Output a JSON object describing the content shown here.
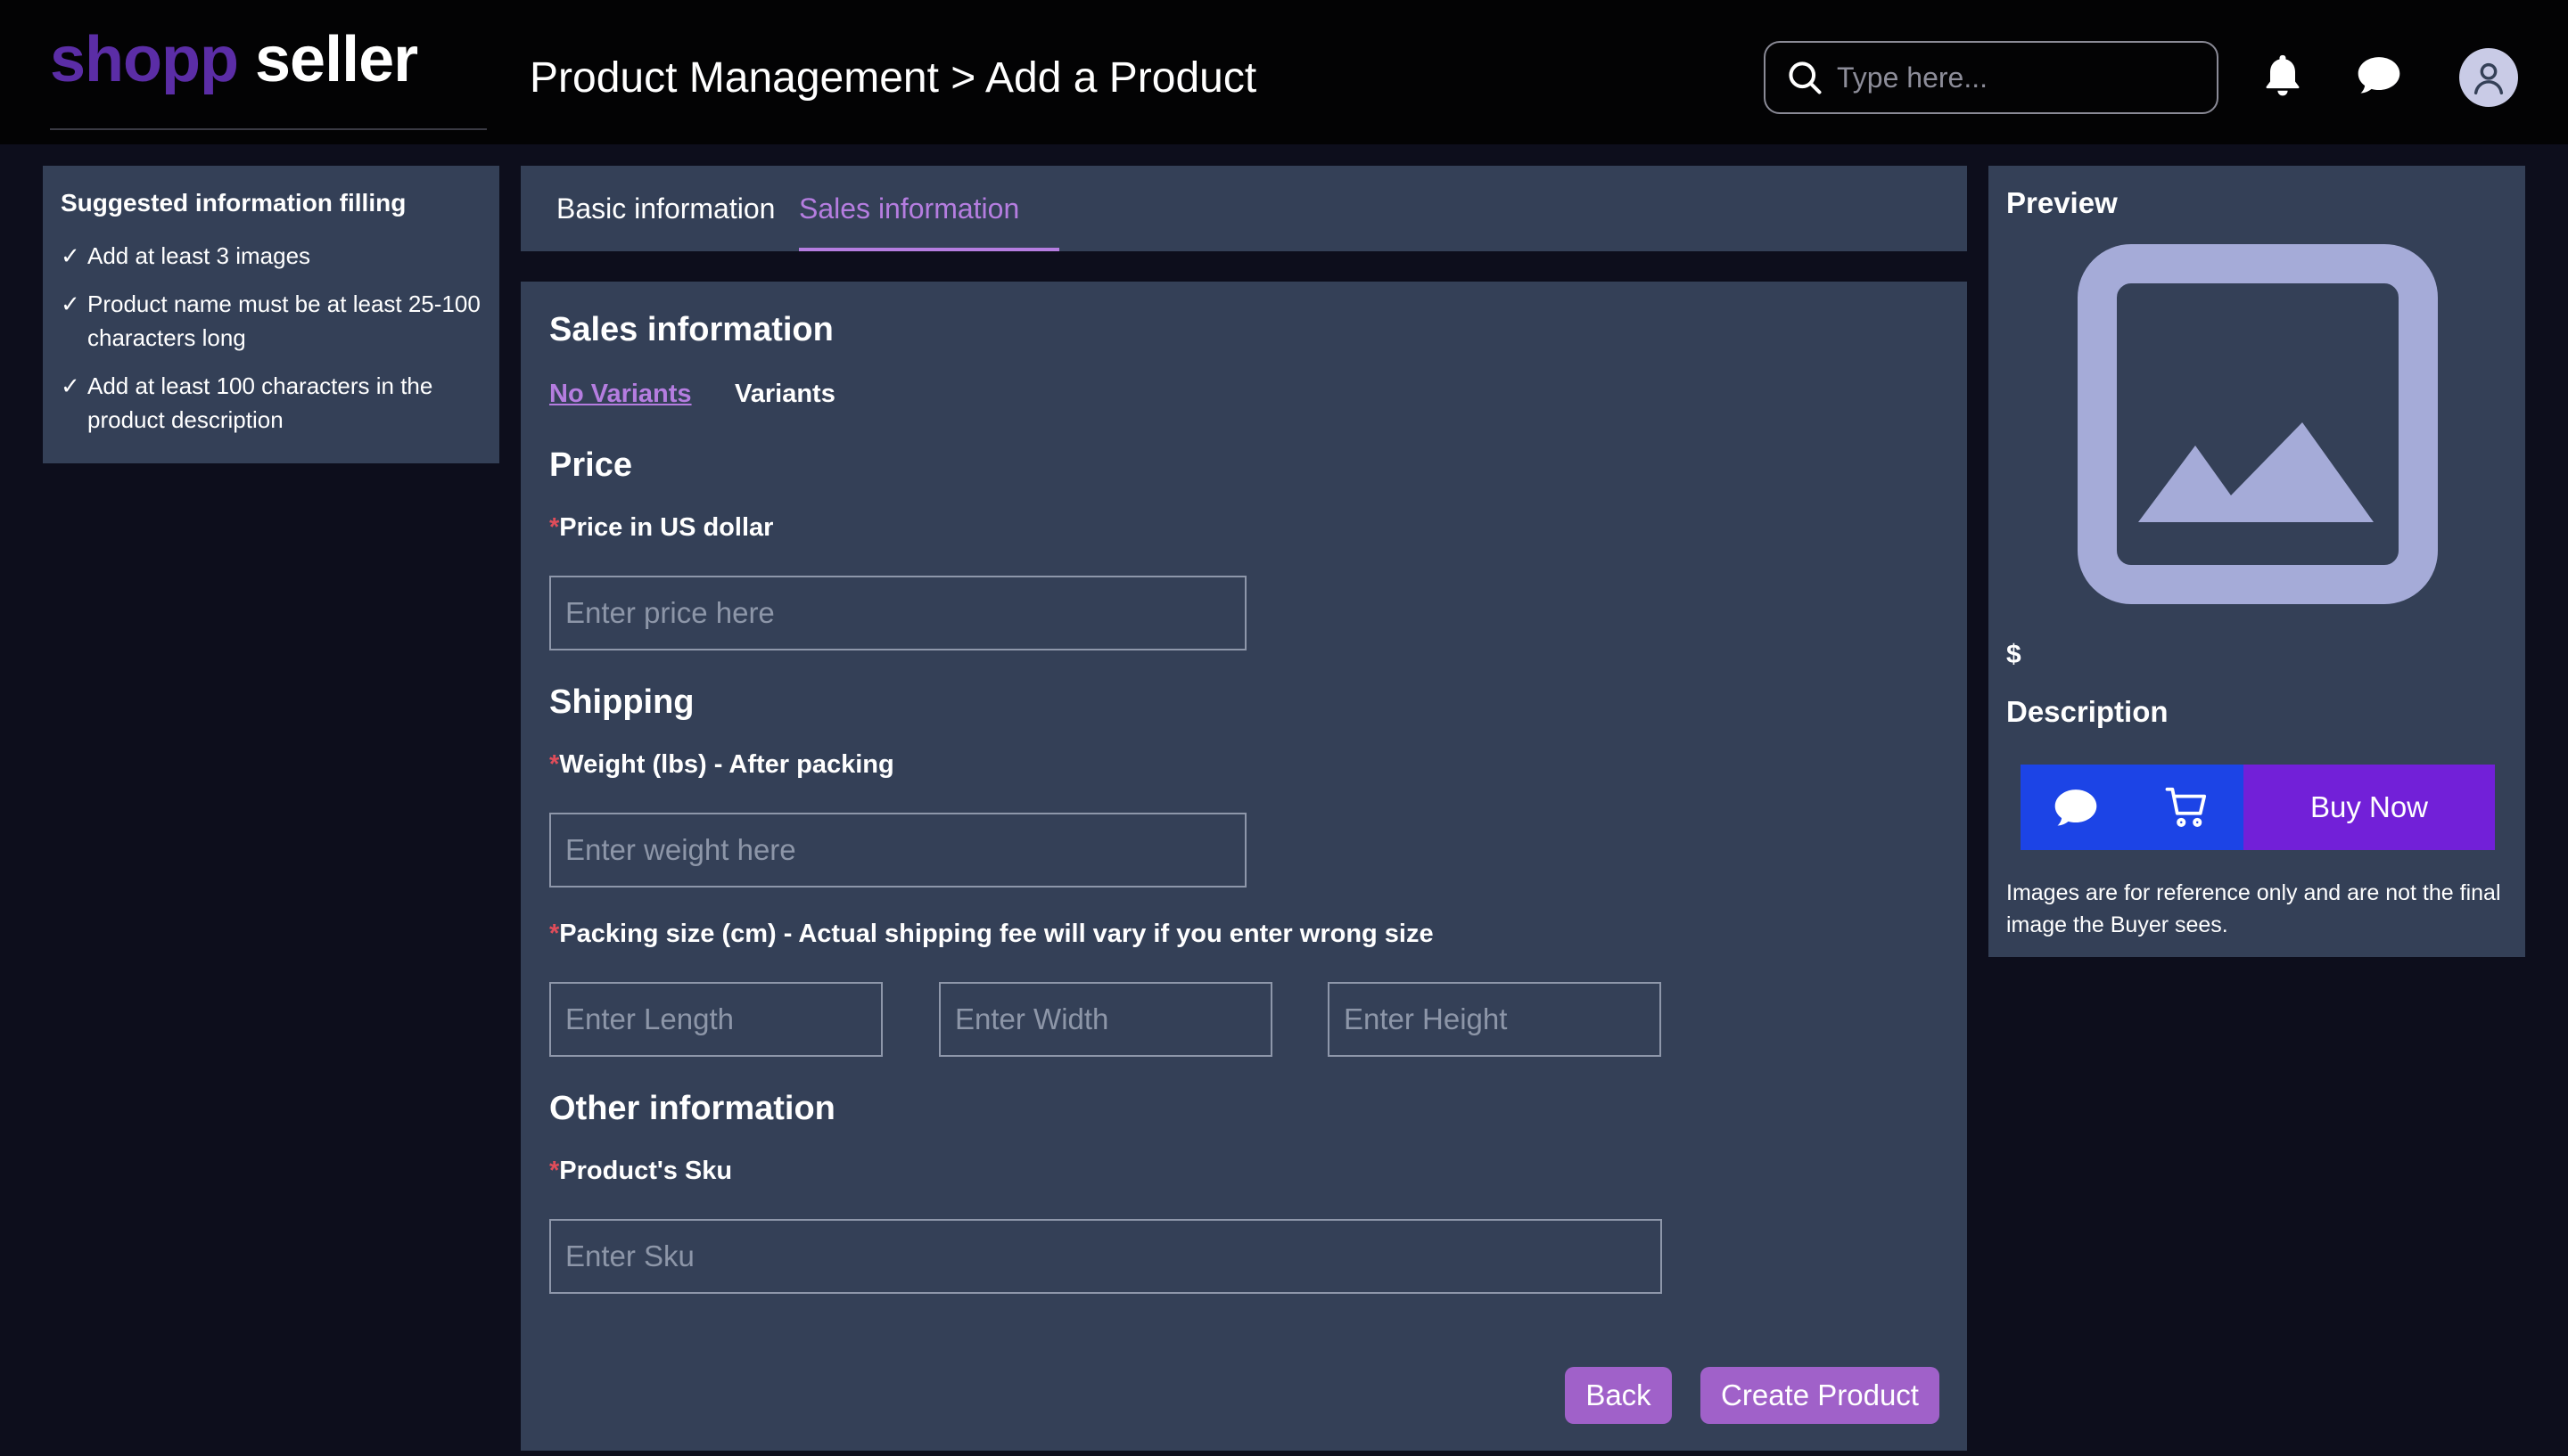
{
  "header": {
    "logo_brand": "shopp",
    "logo_seller": "seller",
    "title": "Product Management > Add a Product",
    "search_placeholder": "Type here...",
    "icons": [
      "search-icon",
      "bell-icon",
      "chat-icon",
      "user-icon"
    ]
  },
  "tips": {
    "title": "Suggested information filling",
    "check": "✓",
    "items": [
      "Add at least 3 images",
      "Product name must be at least 25-100 characters long",
      "Add at least 100 characters in the product description"
    ]
  },
  "tabs": [
    {
      "label": "Basic information",
      "active": false
    },
    {
      "label": "Sales information",
      "active": true
    }
  ],
  "form": {
    "heading": "Sales information",
    "variant_options": [
      "No Variants",
      "Variants"
    ],
    "price": {
      "section": "Price",
      "label": "Price in US dollar",
      "placeholder": "Enter price here"
    },
    "shipping": {
      "section": "Shipping",
      "weight_label": "Weight (lbs) - After packing",
      "weight_placeholder": "Enter weight here",
      "size_label": "Packing size (cm) - Actual shipping fee will vary if you enter wrong size",
      "length_placeholder": "Enter Length",
      "width_placeholder": "Enter Width",
      "height_placeholder": "Enter Height"
    },
    "other": {
      "section": "Other information",
      "sku_label": "Product's Sku",
      "sku_placeholder": "Enter Sku"
    },
    "required_mark": "*",
    "buttons": {
      "back": "Back",
      "create": "Create Product"
    }
  },
  "preview": {
    "title": "Preview",
    "price_sign": "$",
    "description_label": "Description",
    "buy_label": "Buy Now",
    "note": "Images are for reference only and are not the final image the Buyer sees."
  },
  "colors": {
    "brand_purple": "#5b2da6",
    "accent_purple": "#b57de0",
    "button_purple": "#a061c9",
    "panel": "#344057",
    "buy_blue": "#1c44e6",
    "buy_violet": "#7220d8",
    "required_red": "#e04d5a"
  }
}
